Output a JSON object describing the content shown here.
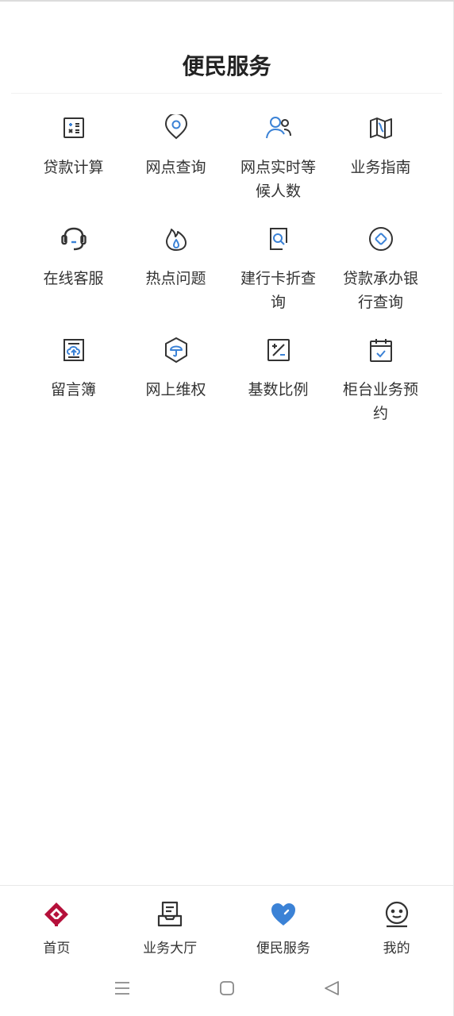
{
  "header": {
    "title": "便民服务"
  },
  "services": [
    {
      "label": "贷款计算",
      "icon": "calculator-icon"
    },
    {
      "label": "网点查询",
      "icon": "location-pin-icon"
    },
    {
      "label": "网点实时等候人数",
      "icon": "people-icon"
    },
    {
      "label": "业务指南",
      "icon": "map-icon"
    },
    {
      "label": "在线客服",
      "icon": "headset-icon"
    },
    {
      "label": "热点问题",
      "icon": "fire-icon"
    },
    {
      "label": "建行卡折查询",
      "icon": "card-search-icon"
    },
    {
      "label": "贷款承办银行查询",
      "icon": "diamond-circle-icon"
    },
    {
      "label": "留言簿",
      "icon": "message-upload-icon"
    },
    {
      "label": "网上维权",
      "icon": "umbrella-shield-icon"
    },
    {
      "label": "基数比例",
      "icon": "plus-minus-icon"
    },
    {
      "label": "柜台业务预约",
      "icon": "calendar-check-icon"
    }
  ],
  "tabbar": [
    {
      "label": "首页",
      "icon": "home-logo-icon"
    },
    {
      "label": "业务大厅",
      "icon": "inbox-hall-icon"
    },
    {
      "label": "便民服务",
      "icon": "heart-icon"
    },
    {
      "label": "我的",
      "icon": "smiley-user-icon"
    }
  ],
  "system_nav": {
    "menu": "menu-icon",
    "home": "home-square-icon",
    "back": "back-triangle-icon"
  },
  "colors": {
    "icon_dark": "#333333",
    "icon_accent": "#3b82d6",
    "brand_red": "#b5103a",
    "heart_blue": "#3b82d6"
  }
}
